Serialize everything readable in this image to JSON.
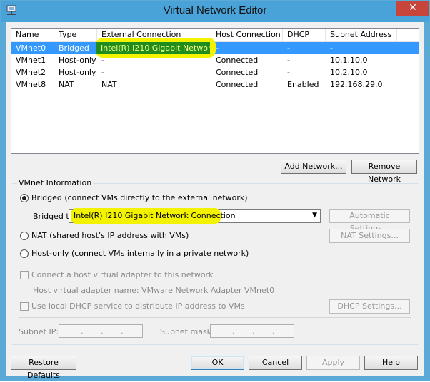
{
  "window": {
    "title": "Virtual Network Editor",
    "close_glyph": "✕"
  },
  "table": {
    "columns": [
      "Name",
      "Type",
      "External Connection",
      "Host Connection",
      "DHCP",
      "Subnet Address"
    ],
    "rows": [
      {
        "name": "VMnet0",
        "type": "Bridged",
        "external": "Intel(R) I210 Gigabit Networ…",
        "host": "-",
        "dhcp": "-",
        "subnet": "-"
      },
      {
        "name": "VMnet1",
        "type": "Host-only",
        "external": "-",
        "host": "Connected",
        "dhcp": "-",
        "subnet": "10.1.10.0"
      },
      {
        "name": "VMnet2",
        "type": "Host-only",
        "external": "-",
        "host": "Connected",
        "dhcp": "-",
        "subnet": "10.2.10.0"
      },
      {
        "name": "VMnet8",
        "type": "NAT",
        "external": "NAT",
        "host": "Connected",
        "dhcp": "Enabled",
        "subnet": "192.168.29.0"
      }
    ]
  },
  "buttons": {
    "add_network": "Add Network...",
    "remove_network": "Remove Network",
    "automatic_settings": "Automatic Settings...",
    "nat_settings": "NAT Settings...",
    "dhcp_settings": "DHCP Settings...",
    "restore_defaults": "Restore Defaults",
    "ok": "OK",
    "cancel": "Cancel",
    "apply": "Apply",
    "help": "Help"
  },
  "vmnet_info": {
    "group_label": "VMnet Information",
    "bridged_label": "Bridged (connect VMs directly to the external network)",
    "bridged_to_label": "Bridged to:",
    "bridged_to_value": "Intel(R) I210 Gigabit Network Connection",
    "nat_label": "NAT (shared host's IP address with VMs)",
    "hostonly_label": "Host-only (connect VMs internally in a private network)",
    "connect_adapter_label": "Connect a host virtual adapter to this network",
    "adapter_name_text": "Host virtual adapter name: VMware Network Adapter VMnet0",
    "dhcp_label": "Use local DHCP service to distribute IP address to VMs",
    "subnet_ip_label": "Subnet IP:",
    "subnet_mask_label": "Subnet mask:",
    "selected_mode": "bridged"
  },
  "colors": {
    "selection": "#3399ff",
    "highlight": "#f3f300",
    "title_bar": "#4aa3d8"
  }
}
